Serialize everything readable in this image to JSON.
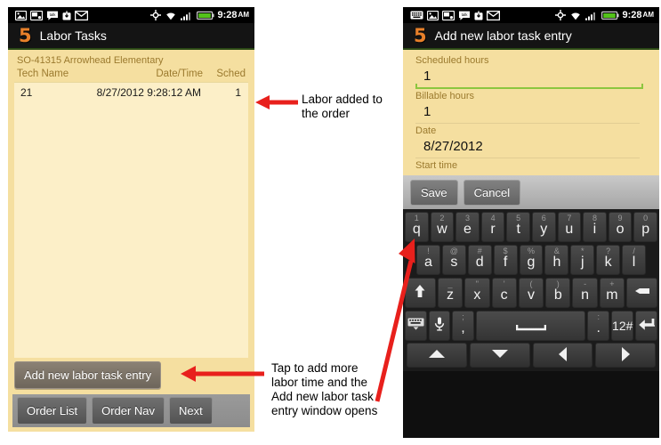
{
  "colors": {
    "accent_orange": "#e8802a",
    "page_tan": "#f5dfa0",
    "list_cream": "#fcefc8",
    "label_brown": "#9b7a2e",
    "focus_green": "#8cc63f",
    "arrow_red": "#e8201c",
    "statusbar_black": "#000000"
  },
  "left_phone": {
    "status_bar": {
      "icons": [
        "photo-icon",
        "sd-card-icon",
        "talk-icon",
        "download-icon",
        "mail-icon"
      ],
      "right_icons": [
        "gps-icon",
        "wifi-icon",
        "signal-icon",
        "battery-icon"
      ],
      "time": "9:28",
      "ampm": "AM"
    },
    "title": "Labor Tasks",
    "logo": "5",
    "order_line": "SO-41315 Arrowhead Elementary",
    "table": {
      "headers": [
        "Tech Name",
        "Date/Time",
        "Sched"
      ],
      "rows": [
        {
          "tech_name": "21",
          "datetime": "8/27/2012 9:28:12 AM",
          "sched": "1"
        }
      ]
    },
    "add_button": "Add new labor task entry",
    "bottom_buttons": [
      "Order List",
      "Order Nav",
      "Next"
    ]
  },
  "right_phone": {
    "status_bar": {
      "icons": [
        "keyboard-icon",
        "photo-icon",
        "sd-card-icon",
        "talk-icon",
        "download-icon",
        "mail-icon"
      ],
      "right_icons": [
        "gps-icon",
        "wifi-icon",
        "signal-icon",
        "battery-icon"
      ],
      "time": "9:28",
      "ampm": "AM"
    },
    "title": "Add new labor task entry",
    "logo": "5",
    "fields": [
      {
        "label": "Scheduled hours",
        "value": "1",
        "focused": true
      },
      {
        "label": "Billable hours",
        "value": "1",
        "focused": false
      },
      {
        "label": "Date",
        "value": "8/27/2012",
        "focused": false
      },
      {
        "label": "Start time",
        "value": "",
        "focused": false
      }
    ],
    "action_buttons": [
      "Save",
      "Cancel"
    ],
    "keyboard": {
      "row1": [
        {
          "alt": "1",
          "key": "q"
        },
        {
          "alt": "2",
          "key": "w"
        },
        {
          "alt": "3",
          "key": "e"
        },
        {
          "alt": "4",
          "key": "r"
        },
        {
          "alt": "5",
          "key": "t"
        },
        {
          "alt": "6",
          "key": "y"
        },
        {
          "alt": "7",
          "key": "u"
        },
        {
          "alt": "8",
          "key": "i"
        },
        {
          "alt": "9",
          "key": "o"
        },
        {
          "alt": "0",
          "key": "p"
        }
      ],
      "row2": [
        {
          "alt": "!",
          "key": "a"
        },
        {
          "alt": "@",
          "key": "s"
        },
        {
          "alt": "#",
          "key": "d"
        },
        {
          "alt": "$",
          "key": "f"
        },
        {
          "alt": "%",
          "key": "g"
        },
        {
          "alt": "&",
          "key": "h"
        },
        {
          "alt": "*",
          "key": "j"
        },
        {
          "alt": "?",
          "key": "k"
        },
        {
          "alt": "/",
          "key": "l"
        }
      ],
      "row3": [
        {
          "alt": "",
          "key": "",
          "icon": "shift-up-arrow-icon"
        },
        {
          "alt": "_",
          "key": "z"
        },
        {
          "alt": "\"",
          "key": "x"
        },
        {
          "alt": "'",
          "key": "c"
        },
        {
          "alt": "(",
          "key": "v"
        },
        {
          "alt": ")",
          "key": "b"
        },
        {
          "alt": "-",
          "key": "n"
        },
        {
          "alt": "+",
          "key": "m"
        },
        {
          "alt": "",
          "key": "",
          "icon": "backspace-icon"
        }
      ],
      "row4": [
        {
          "key": "",
          "icon": "hide-keyboard-icon"
        },
        {
          "key": "",
          "icon": "microphone-icon"
        },
        {
          "alt": ";",
          "key": ","
        },
        {
          "key": "",
          "icon": "spacebar-icon"
        },
        {
          "alt": ":",
          "key": "."
        },
        {
          "key": "12#"
        },
        {
          "key": "",
          "icon": "enter-icon"
        }
      ],
      "nav_row": [
        "up-arrow-icon",
        "down-arrow-icon",
        "left-arrow-icon",
        "right-arrow-icon"
      ]
    }
  },
  "annotations": [
    {
      "id": "labor-added",
      "text": "Labor added to the order"
    },
    {
      "id": "tap-to-add",
      "text": "Tap to add more labor time and the Add new labor task entry window opens"
    }
  ]
}
